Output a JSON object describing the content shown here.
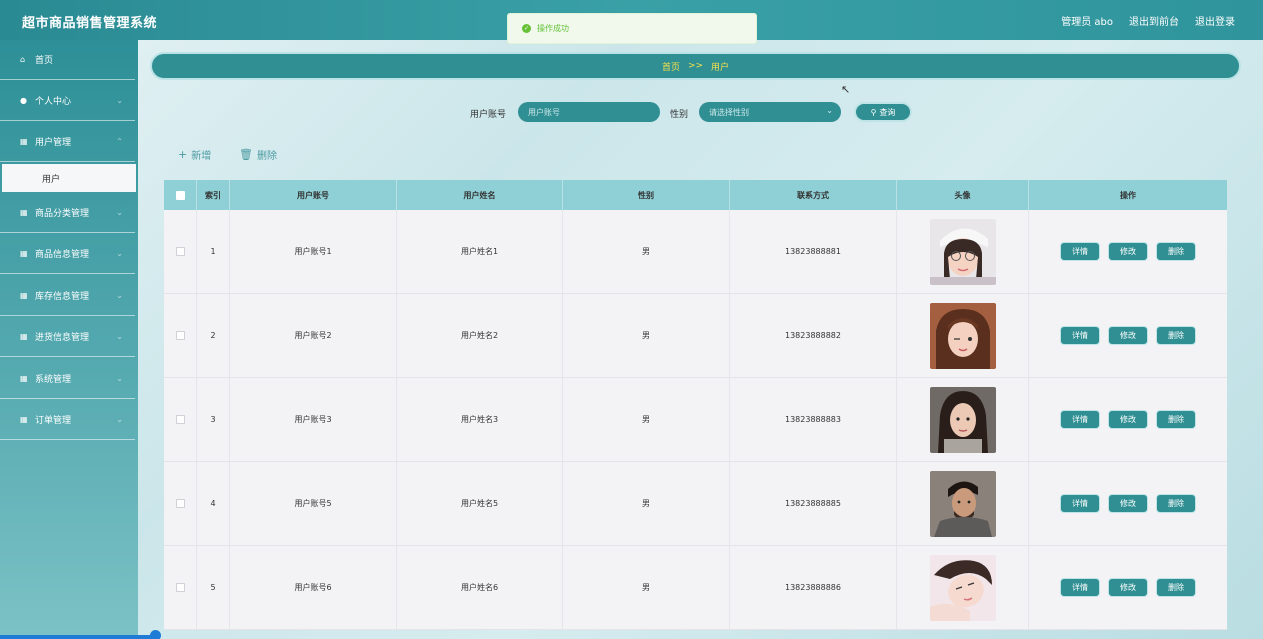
{
  "header": {
    "app_title": "超市商品销售管理系统",
    "admin_label": "管理员 abo",
    "front_link": "退出到前台",
    "logout_link": "退出登录"
  },
  "toast": {
    "message": "操作成功",
    "icon": "success-check-icon",
    "color": "#67c23a"
  },
  "sidebar": {
    "items": [
      {
        "label": "首页",
        "icon": "home-icon"
      },
      {
        "label": "个人中心",
        "icon": "user-icon"
      },
      {
        "label": "用户管理",
        "icon": "grid-icon"
      },
      {
        "label": "商品分类管理",
        "icon": "grid-icon"
      },
      {
        "label": "商品信息管理",
        "icon": "grid-icon"
      },
      {
        "label": "库存信息管理",
        "icon": "grid-icon"
      },
      {
        "label": "进货信息管理",
        "icon": "grid-icon"
      },
      {
        "label": "系统管理",
        "icon": "grid-icon"
      },
      {
        "label": "订单管理",
        "icon": "grid-icon"
      }
    ],
    "active_sub": "用户"
  },
  "breadcrumb": {
    "home": "首页",
    "separator": ">>",
    "current": "用户"
  },
  "search": {
    "account_label": "用户账号",
    "account_placeholder": "用户账号",
    "gender_label": "性别",
    "gender_placeholder": "请选择性别",
    "query_button": "查询"
  },
  "actions": {
    "add": "新增",
    "delete": "删除"
  },
  "table": {
    "headers": [
      "索引",
      "用户账号",
      "用户姓名",
      "性别",
      "联系方式",
      "头像",
      "操作"
    ],
    "rows": [
      {
        "index": "1",
        "account": "用户账号1",
        "name": "用户姓名1",
        "gender": "男",
        "phone": "13823888881"
      },
      {
        "index": "2",
        "account": "用户账号2",
        "name": "用户姓名2",
        "gender": "男",
        "phone": "13823888882"
      },
      {
        "index": "3",
        "account": "用户账号3",
        "name": "用户姓名3",
        "gender": "男",
        "phone": "13823888883"
      },
      {
        "index": "4",
        "account": "用户账号5",
        "name": "用户姓名5",
        "gender": "男",
        "phone": "13823888885"
      },
      {
        "index": "5",
        "account": "用户账号6",
        "name": "用户姓名6",
        "gender": "男",
        "phone": "13823888886"
      }
    ],
    "row_buttons": {
      "detail": "详情",
      "edit": "修改",
      "delete": "删除"
    }
  },
  "colors": {
    "primary": "#2f8f93",
    "header_bg": "#8fd0d6",
    "breadcrumb_text": "#f4e04d"
  }
}
